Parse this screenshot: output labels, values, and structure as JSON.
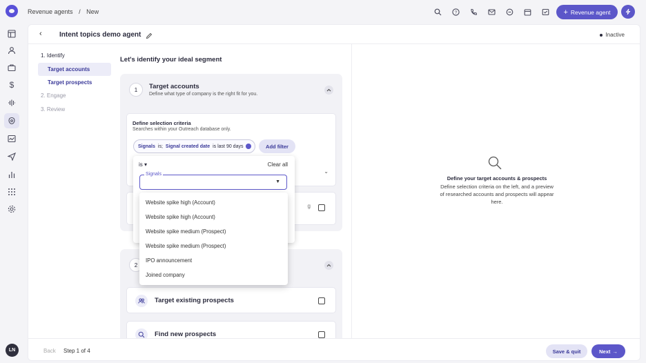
{
  "topbar": {
    "breadcrumb_root": "Revenue agents",
    "breadcrumb_sep": "/",
    "breadcrumb_current": "New",
    "revenue_button": "Revenue agent"
  },
  "user": {
    "initials": "LN"
  },
  "header": {
    "title": "Intent topics demo agent",
    "status": "Inactive"
  },
  "steps": {
    "identify": "1. Identify",
    "target_accounts": "Target accounts",
    "target_prospects": "Target prospects",
    "engage": "2. Engage",
    "review": "3. Review"
  },
  "main": {
    "heading": "Let's identify your ideal segment",
    "section1": {
      "number": "1",
      "title": "Target accounts",
      "subtitle": "Define what type of company is the right fit for you.",
      "criteria_label": "Define selection criteria",
      "criteria_sub": "Searches within your Outreach database only.",
      "chip_signals": "Signals",
      "chip_is": "is;",
      "chip_date": "Signal created date",
      "chip_rest": "is last 90 days",
      "add_filter": "Add filter"
    },
    "section2": {
      "number": "2",
      "existing": "Target existing prospects",
      "find_new": "Find new prospects"
    }
  },
  "popover": {
    "operator": "is",
    "clear_all": "Clear all",
    "select_label": "Signals",
    "options": [
      "Website spike high (Account)",
      "Website spike high (Account)",
      "Website spike medium (Prospect)",
      "Website spike medium (Prospect)",
      "IPO announcement",
      "Joined company"
    ]
  },
  "preview": {
    "title": "Define your target accounts & prospects",
    "text": "Define selection criteria on the left, and a preview of researched accounts and prospects will appear here."
  },
  "footer": {
    "back": "Back",
    "step": "Step 1 of 4",
    "save_quit": "Save & quit",
    "next": "Next"
  },
  "colors": {
    "accent": "#5c57c9"
  }
}
